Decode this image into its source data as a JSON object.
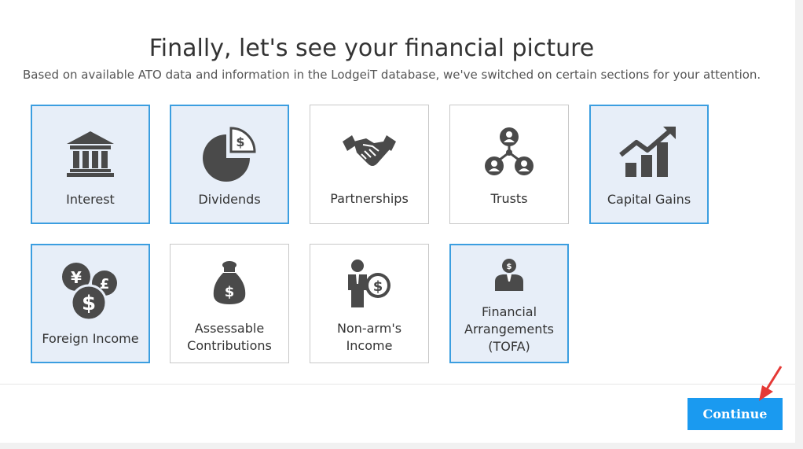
{
  "page": {
    "title": "Finally, let's see your financial picture",
    "subtitle": "Based on available ATO data and information in the LodgeiT database, we've switched on certain sections for your attention."
  },
  "cards": [
    {
      "label": "Interest",
      "icon": "bank-icon",
      "selected": true
    },
    {
      "label": "Dividends",
      "icon": "pie-chart-dollar-icon",
      "selected": true
    },
    {
      "label": "Partnerships",
      "icon": "handshake-icon",
      "selected": false
    },
    {
      "label": "Trusts",
      "icon": "people-network-icon",
      "selected": false
    },
    {
      "label": "Capital Gains",
      "icon": "growth-chart-icon",
      "selected": true
    },
    {
      "label": "Foreign Income",
      "icon": "currency-coins-icon",
      "selected": true
    },
    {
      "label": "Assessable Contributions",
      "icon": "money-bag-icon",
      "selected": false
    },
    {
      "label": "Non-arm's Income",
      "icon": "person-dollar-icon",
      "selected": false
    },
    {
      "label": "Financial Arrangements (TOFA)",
      "icon": "businessman-dollar-icon",
      "selected": true
    }
  ],
  "footer": {
    "continue_label": "Continue"
  },
  "colors": {
    "accent": "#1a9af0",
    "selected_border": "#3b9ee0",
    "selected_bg": "#e7eef8",
    "icon": "#4a4a4a",
    "annotation_arrow": "#e53935"
  }
}
